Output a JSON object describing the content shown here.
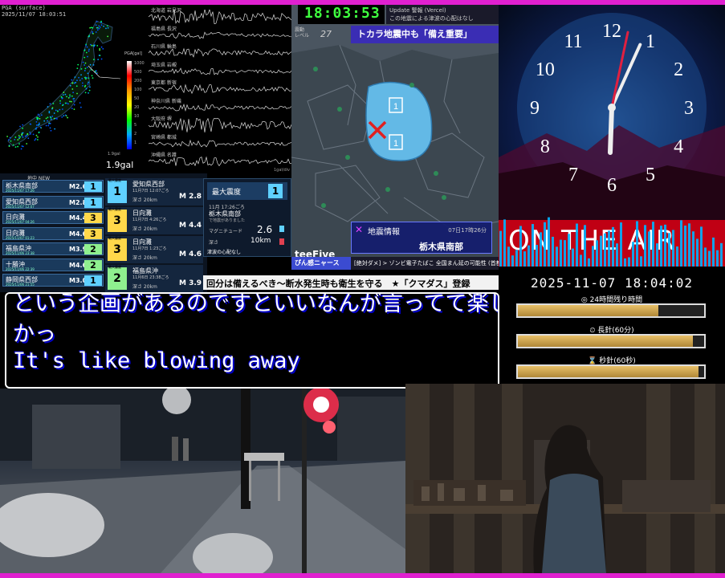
{
  "seismic_map": {
    "header": "PGA (surface)",
    "timestamp": "2025/11/07 18:03:51",
    "scale_title": "PGA[gal]",
    "scale_ticks": [
      "1000",
      "500",
      "200",
      "100",
      "50",
      "20",
      "10",
      "5",
      "2",
      "1"
    ],
    "reading_small": "1.9gal",
    "reading": "1.9gal"
  },
  "waveforms": {
    "stations": [
      "北海道 岩見沢",
      "福島県 長沢",
      "石川県 輪島",
      "埼玉県 岩槻",
      "東京都 新宿",
      "神奈川県 新磯",
      "大阪府 堺",
      "宮崎県 都城",
      "沖縄県 名護"
    ],
    "footer": "1gal/div"
  },
  "quake_list": {
    "header": "地中 NEW",
    "rows": [
      {
        "name": "栃木県南部",
        "date": "2025/11/07 17:26",
        "mag": "M2.6",
        "int": "1",
        "color": "#5fd0ff"
      },
      {
        "name": "愛知県西部",
        "date": "2025/11/07 12:07",
        "mag": "M2.8",
        "int": "1",
        "color": "#5fd0ff"
      },
      {
        "name": "日向灘",
        "date": "2025/11/07 04:26",
        "mag": "M4.4",
        "int": "3",
        "color": "#ffd84a"
      },
      {
        "name": "日向灘",
        "date": "2025/11/07 01:23",
        "mag": "M4.6",
        "int": "3",
        "color": "#ffd84a"
      },
      {
        "name": "福島県沖",
        "date": "2025/11/06 23:38",
        "mag": "M3.9",
        "int": "2",
        "color": "#8ff08f"
      },
      {
        "name": "十勝沖",
        "date": "2025/11/06 22:39",
        "mag": "M4.6",
        "int": "2",
        "color": "#8ff08f"
      },
      {
        "name": "静岡県西部",
        "date": "2025/11/06 21:55",
        "mag": "M3.0",
        "int": "1",
        "color": "#5fd0ff"
      }
    ],
    "cards": [
      {
        "label": "最大震度",
        "int": "1",
        "color": "#5fd0ff",
        "name": "愛知県西部",
        "date": "11月7日 12:07ごろ",
        "depth": "深さ 20km",
        "mag": "M 2.8"
      },
      {
        "label": "最大震度",
        "int": "3",
        "color": "#ffd84a",
        "name": "日向灘",
        "date": "11月7日 4:26ごろ",
        "depth": "深さ 20km",
        "mag": "M 4.4"
      },
      {
        "label": "最大震度",
        "int": "3",
        "color": "#ffd84a",
        "name": "日向灘",
        "date": "11月7日 1:23ごろ",
        "depth": "深さ 20km",
        "mag": "M 4.6"
      },
      {
        "label": "最大震度",
        "int": "2",
        "color": "#8ff08f",
        "name": "福島県沖",
        "date": "11月6日 23:38ごろ",
        "depth": "深さ 20km",
        "mag": "M 3.9"
      }
    ]
  },
  "max_intensity": {
    "title": "最大震度",
    "value": "1",
    "time": "11月 17:26ごろ",
    "place": "栃木県南部",
    "sub": "で地震がありました",
    "mag_label": "マグニチュード",
    "mag": "2.6",
    "depth_label": "深さ",
    "depth": "10km",
    "tsunami": "津波の心配なし"
  },
  "center_map": {
    "clock": "18:03:53",
    "alert_line1": "Update 警報 (Vercel)",
    "alert_line2": "この地震による津波の心配はなし",
    "level_label": "震動\nレベル",
    "level": "27",
    "banner": "トカラ地震中も「備え重要」",
    "brand": "teeFive",
    "info_title": "地震情報",
    "info_date": "07日17時26分",
    "info_place": "栃木県南部",
    "news_tag": "ぴん感ニャース",
    "news_text": "[絶対ダメ] > ゾンビ電子たばこ 全国まん延の可能性 (首都圏でZ世代拡大か?)",
    "ticker": "回分は備えるべき～断水発生時も衛生を守る　★「クマダス」登録"
  },
  "clock_face": {
    "numbers": [
      "12",
      "1",
      "2",
      "3",
      "4",
      "5",
      "6",
      "7",
      "8",
      "9",
      "10",
      "11"
    ],
    "on_air": "ON THE AIR",
    "time": {
      "h": 18,
      "m": 4,
      "s": 2
    }
  },
  "time_panel": {
    "datetime": "2025-11-07 18:04:02",
    "bars": [
      {
        "label": "◎ 24時間残り時間",
        "progress": 0.755
      },
      {
        "label": "⏲ 長針(60分)",
        "progress": 0.94
      },
      {
        "label": "⌛ 秒針(60秒)",
        "progress": 0.97
      }
    ]
  },
  "caption": {
    "line1": "という企画があるのですといいなんが言ってて楽し",
    "line2": "かっ",
    "line3": "It's like blowing away"
  }
}
